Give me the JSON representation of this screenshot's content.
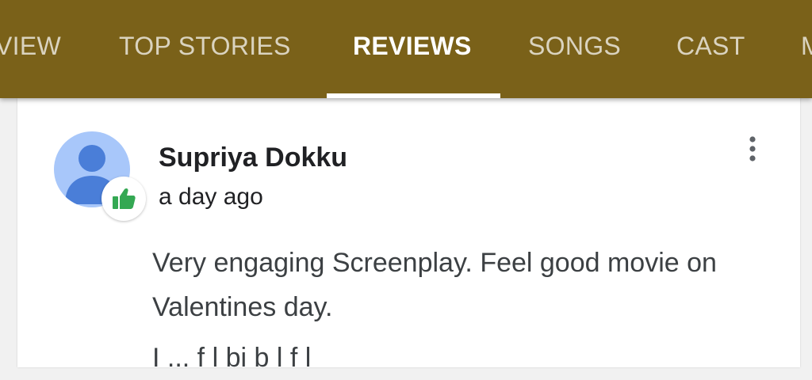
{
  "tabs": [
    {
      "label": "VIEW"
    },
    {
      "label": "TOP STORIES"
    },
    {
      "label": "REVIEWS",
      "active": true
    },
    {
      "label": "SONGS"
    },
    {
      "label": "CAST"
    },
    {
      "label": "M"
    }
  ],
  "review": {
    "reviewer_name": "Supriya Dokku",
    "time_ago": "a day ago",
    "text": "Very engaging Screenplay. Feel good movie on Valentines day.",
    "next_line_partial": "I    ...  f      l  bi  b  l  f l",
    "avatar_icon": "person-icon",
    "badge_icon": "thumbs-up-icon",
    "menu_icon": "more-vert-icon"
  },
  "colors": {
    "tabbar_bg": "#7a6119",
    "tab_active": "#ffffff",
    "avatar_bg": "#a8c7fa",
    "avatar_fg": "#4a7ed8",
    "thumb_green": "#34a853"
  }
}
